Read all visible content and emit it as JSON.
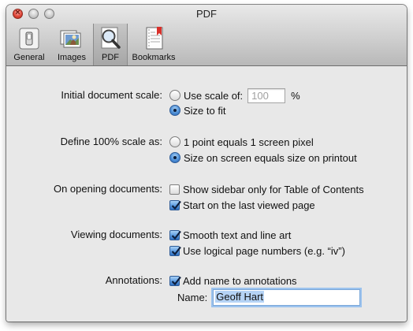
{
  "window": {
    "title": "PDF"
  },
  "toolbar": {
    "tabs": [
      {
        "label": "General",
        "icon": "general-switch-icon",
        "selected": false
      },
      {
        "label": "Images",
        "icon": "images-icon",
        "selected": false
      },
      {
        "label": "PDF",
        "icon": "magnifier-icon",
        "selected": true
      },
      {
        "label": "Bookmarks",
        "icon": "bookmarks-icon",
        "selected": false
      }
    ]
  },
  "settings": {
    "initial_scale": {
      "label": "Initial document scale:",
      "use_scale_label": "Use scale of:",
      "scale_value": "100",
      "percent": "%",
      "size_to_fit_label": "Size to fit",
      "selected": "size_to_fit"
    },
    "define_scale": {
      "label": "Define 100% scale as:",
      "option1": "1 point equals 1 screen pixel",
      "option2": "Size on screen equals size on printout",
      "selected": "option2"
    },
    "opening": {
      "label": "On opening documents:",
      "sidebar_label": "Show sidebar only for Table of Contents",
      "sidebar_checked": false,
      "last_page_label": "Start on the last viewed page",
      "last_page_checked": true
    },
    "viewing": {
      "label": "Viewing documents:",
      "smooth_label": "Smooth text and line art",
      "smooth_checked": true,
      "logical_label": "Use logical page numbers (e.g. “iv”)",
      "logical_checked": true
    },
    "annotations": {
      "label": "Annotations:",
      "add_name_label": "Add name to annotations",
      "add_name_checked": true,
      "name_label": "Name:",
      "name_value": "Geoff Hart"
    }
  },
  "colors": {
    "accent": "#3d7ccf",
    "window_bg": "#e8e8e8"
  }
}
